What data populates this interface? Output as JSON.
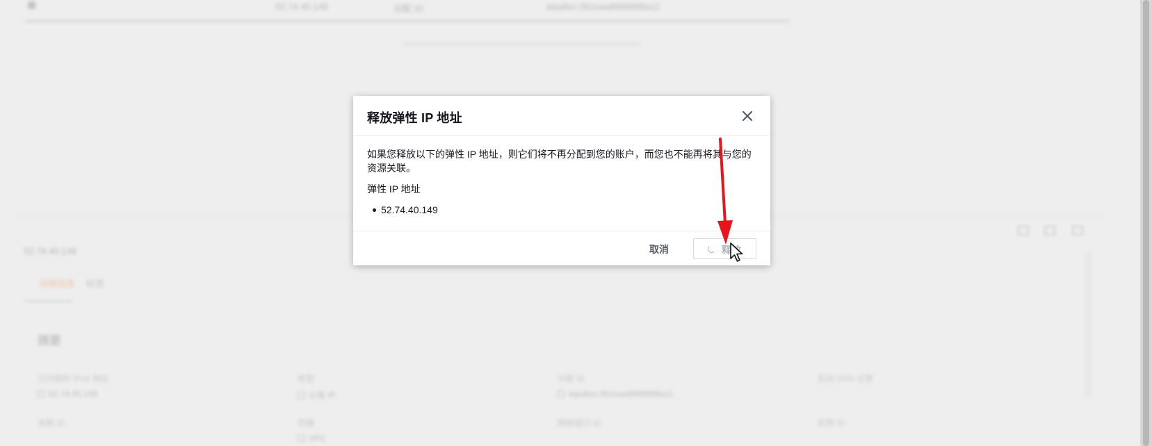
{
  "background": {
    "table_row": {
      "col1": "",
      "col2": "52.74.40.149",
      "col3": "分配 ID",
      "col4": "eipalloc-0b1eaa8888888a11"
    },
    "detail_ip_title": "52.74.40.149",
    "tabs": [
      "详细信息",
      "标签"
    ],
    "section_title": "摘要",
    "fields": [
      {
        "label": "已分配的 IPv4 地址",
        "value": "52.74.40.149"
      },
      {
        "label": "类型",
        "value": "公有 IP"
      },
      {
        "label": "分配 ID",
        "value": "eipalloc-0b1eaa8888888a11"
      },
      {
        "label": "反向 DNS 记录",
        "value": ""
      },
      {
        "label": "关联 ID",
        "value": ""
      },
      {
        "label": "范围",
        "value": "VPC"
      },
      {
        "label": "网络接口 ID",
        "value": ""
      },
      {
        "label": "实例 ID",
        "value": ""
      }
    ]
  },
  "dialog": {
    "title": "释放弹性 IP 地址",
    "description": "如果您释放以下的弹性 IP 地址，则它们将不再分配到您的账户，而您也不能再将其与您的资源关联。",
    "list_label": "弹性 IP 地址",
    "ip_addresses": [
      "52.74.40.149"
    ],
    "cancel_label": "取消",
    "release_label": "释放"
  },
  "icons": {
    "close": "close-icon",
    "spinner": "loading-spinner-icon",
    "cursor": "mouse-pointer-icon",
    "annotation": "red-arrow-annotation"
  },
  "colors": {
    "overlay_bg": "#eeeeee",
    "dialog_bg": "#ffffff",
    "text_primary": "#16191f",
    "disabled_text": "#aab7b8",
    "annotation_red": "#e8141c"
  }
}
